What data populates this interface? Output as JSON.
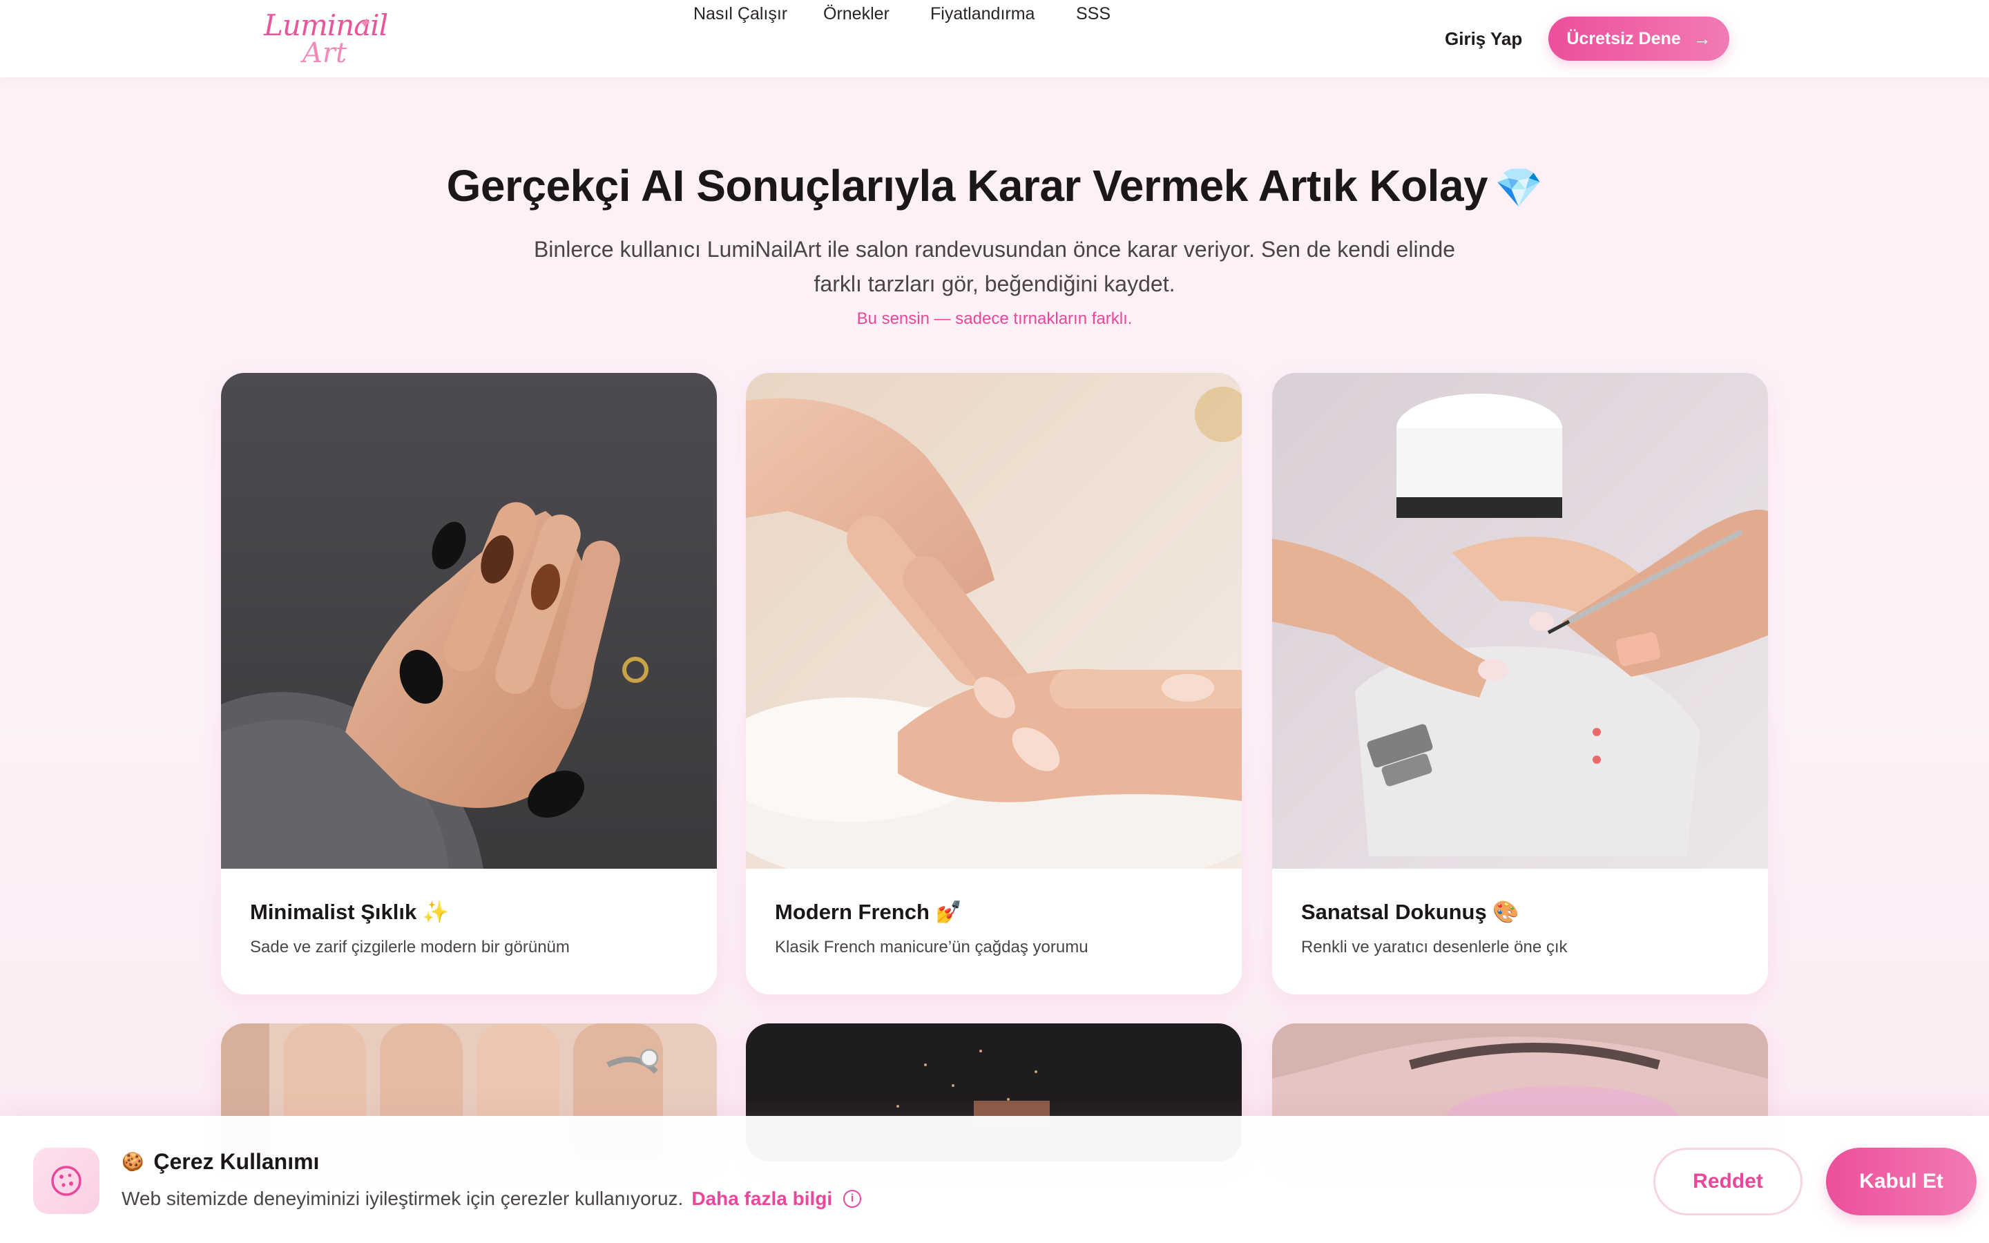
{
  "brand": {
    "logo_line1": "Luminail",
    "logo_line2": "Art",
    "accent_color": "#e8479a"
  },
  "nav": {
    "items": [
      {
        "label": "Nasıl Çalışır"
      },
      {
        "label": "Örnekler"
      },
      {
        "label": "Fiyatlandırma"
      },
      {
        "label": "SSS"
      }
    ],
    "login_label": "Giriş Yap",
    "cta_label": "Ücretsiz Dene",
    "cta_icon": "arrow-right-icon"
  },
  "hero": {
    "title": "Gerçekçi AI Sonuçlarıyla Karar Vermek Artık Kolay",
    "title_icon": "gem-icon",
    "subtitle": "Binlerce kullanıcı LumiNailArt ile salon randevusundan önce karar veriyor. Sen de kendi elinde farklı tarzları gör, beğendiğini kaydet.",
    "note": "Bu sensin — sadece tırnakların farklı."
  },
  "cards": [
    {
      "title": "Minimalist Şıklık",
      "emoji": "✨",
      "description": "Sade ve zarif çizgilerle modern bir görünüm",
      "image": "black-tortoise-nails-photo"
    },
    {
      "title": "Modern French",
      "emoji": "💅",
      "description": "Klasik French manicure’ün çağdaş yorumu",
      "image": "nude-french-nails-photo"
    },
    {
      "title": "Sanatsal Dokunuş",
      "emoji": "🎨",
      "description": "Renkli ve yaratıcı desenlerle öne çık",
      "image": "nail-art-salon-photo"
    }
  ],
  "cookie": {
    "icon": "cookie-icon",
    "emoji": "🍪",
    "title": "Çerez Kullanımı",
    "text": "Web sitemizde deneyiminizi iyileştirmek için çerezler kullanıyoruz.",
    "link": "Daha fazla bilgi",
    "reject_label": "Reddet",
    "accept_label": "Kabul Et"
  }
}
